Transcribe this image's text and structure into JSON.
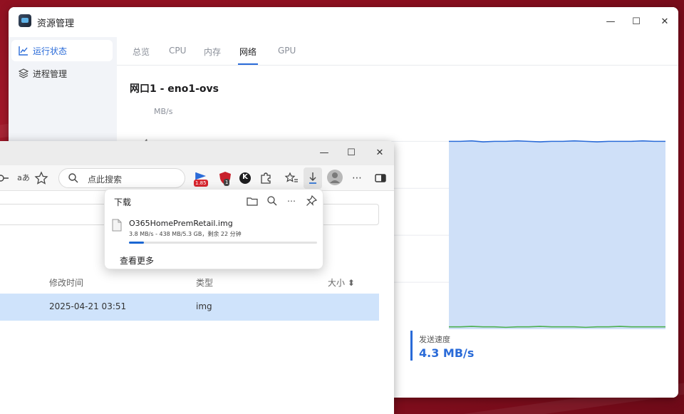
{
  "resource_manager": {
    "title": "资源管理",
    "window_controls": {
      "minimize": "—",
      "maximize": "☐",
      "close": "✕"
    },
    "sidebar": [
      {
        "label": "运行状态",
        "icon": "line-chart-icon",
        "active": true
      },
      {
        "label": "进程管理",
        "icon": "layers-icon",
        "active": false
      }
    ],
    "tabs": [
      {
        "label": "总览",
        "active": false
      },
      {
        "label": "CPU",
        "active": false
      },
      {
        "label": "内存",
        "active": false
      },
      {
        "label": "网络",
        "active": true
      },
      {
        "label": "GPU",
        "active": false
      }
    ],
    "heading": "网口1 - eno1-ovs",
    "unit": "MB/s",
    "send_speed": {
      "label": "发送速度",
      "value": "4.3 MB/s"
    },
    "accent_color": "#2a6bd8"
  },
  "chart_data": {
    "type": "area",
    "ylabel": "MB/s",
    "y_ticks": [
      "4"
    ],
    "ylim": [
      0,
      4.4
    ],
    "grid": true,
    "series": [
      {
        "color": "#2a6bd8",
        "fill": "#cfe0f8",
        "values": [
          4.0,
          4.0,
          4.01,
          3.99,
          4.0,
          4.0,
          4.01,
          4.0,
          3.99,
          4.0,
          4.0,
          4.01,
          4.0,
          3.99,
          4.0,
          4.0,
          4.0,
          4.01,
          4.0,
          4.0
        ]
      },
      {
        "color": "#4caf50",
        "values": [
          0.05,
          0.05,
          0.06,
          0.05,
          0.05,
          0.04,
          0.05,
          0.05,
          0.06,
          0.05,
          0.05,
          0.05,
          0.04,
          0.05,
          0.05,
          0.06,
          0.05,
          0.05,
          0.05,
          0.05
        ]
      }
    ]
  },
  "browser": {
    "window_controls": {
      "minimize": "—",
      "maximize": "☐",
      "close": "✕"
    },
    "toolbar": {
      "read_aloud": "aあ",
      "search_placeholder": "点此搜索",
      "ext_badge_1": "1.85",
      "ext_badge_2": "1",
      "ext_letter": "K"
    },
    "file_list": {
      "columns": [
        "修改时间",
        "类型",
        "大小 ⬍"
      ],
      "rows": [
        {
          "modified": "2025-04-21 03:51",
          "type": "img"
        }
      ]
    },
    "downloads": {
      "title": "下载",
      "filename": "O365HomePremRetail.img",
      "status": "3.8 MB/s - 438 MB/5.3 GB，剩余 22 分钟",
      "progress": 0.08,
      "see_more": "查看更多"
    }
  }
}
